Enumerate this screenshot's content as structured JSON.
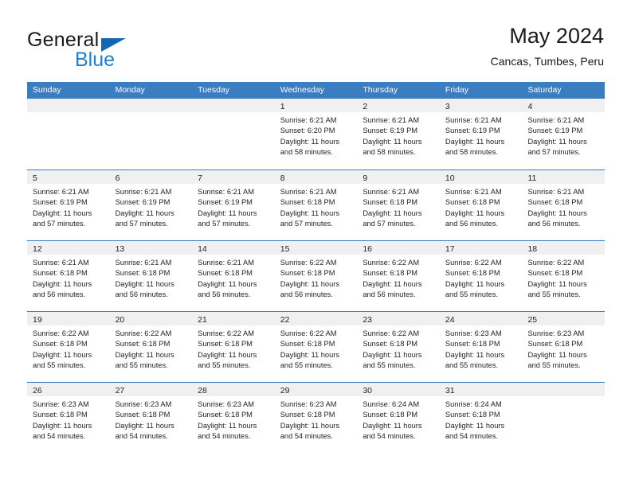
{
  "brand": {
    "name_part1": "General",
    "name_part2": "Blue",
    "triangle_color": "#1267b2",
    "blue_color": "#1d7fd1"
  },
  "header": {
    "title": "May 2024",
    "subtitle": "Cancas, Tumbes, Peru"
  },
  "theme": {
    "header_blue": "#3a7dc0",
    "daynum_band": "#f0f0f0",
    "text": "#231f20"
  },
  "weekdays": [
    "Sunday",
    "Monday",
    "Tuesday",
    "Wednesday",
    "Thursday",
    "Friday",
    "Saturday"
  ],
  "weeks": [
    [
      {
        "day": "",
        "sunrise": "",
        "sunset": "",
        "daylight1": "",
        "daylight2": ""
      },
      {
        "day": "",
        "sunrise": "",
        "sunset": "",
        "daylight1": "",
        "daylight2": ""
      },
      {
        "day": "",
        "sunrise": "",
        "sunset": "",
        "daylight1": "",
        "daylight2": ""
      },
      {
        "day": "1",
        "sunrise": "Sunrise: 6:21 AM",
        "sunset": "Sunset: 6:20 PM",
        "daylight1": "Daylight: 11 hours",
        "daylight2": "and 58 minutes."
      },
      {
        "day": "2",
        "sunrise": "Sunrise: 6:21 AM",
        "sunset": "Sunset: 6:19 PM",
        "daylight1": "Daylight: 11 hours",
        "daylight2": "and 58 minutes."
      },
      {
        "day": "3",
        "sunrise": "Sunrise: 6:21 AM",
        "sunset": "Sunset: 6:19 PM",
        "daylight1": "Daylight: 11 hours",
        "daylight2": "and 58 minutes."
      },
      {
        "day": "4",
        "sunrise": "Sunrise: 6:21 AM",
        "sunset": "Sunset: 6:19 PM",
        "daylight1": "Daylight: 11 hours",
        "daylight2": "and 57 minutes."
      }
    ],
    [
      {
        "day": "5",
        "sunrise": "Sunrise: 6:21 AM",
        "sunset": "Sunset: 6:19 PM",
        "daylight1": "Daylight: 11 hours",
        "daylight2": "and 57 minutes."
      },
      {
        "day": "6",
        "sunrise": "Sunrise: 6:21 AM",
        "sunset": "Sunset: 6:19 PM",
        "daylight1": "Daylight: 11 hours",
        "daylight2": "and 57 minutes."
      },
      {
        "day": "7",
        "sunrise": "Sunrise: 6:21 AM",
        "sunset": "Sunset: 6:19 PM",
        "daylight1": "Daylight: 11 hours",
        "daylight2": "and 57 minutes."
      },
      {
        "day": "8",
        "sunrise": "Sunrise: 6:21 AM",
        "sunset": "Sunset: 6:18 PM",
        "daylight1": "Daylight: 11 hours",
        "daylight2": "and 57 minutes."
      },
      {
        "day": "9",
        "sunrise": "Sunrise: 6:21 AM",
        "sunset": "Sunset: 6:18 PM",
        "daylight1": "Daylight: 11 hours",
        "daylight2": "and 57 minutes."
      },
      {
        "day": "10",
        "sunrise": "Sunrise: 6:21 AM",
        "sunset": "Sunset: 6:18 PM",
        "daylight1": "Daylight: 11 hours",
        "daylight2": "and 56 minutes."
      },
      {
        "day": "11",
        "sunrise": "Sunrise: 6:21 AM",
        "sunset": "Sunset: 6:18 PM",
        "daylight1": "Daylight: 11 hours",
        "daylight2": "and 56 minutes."
      }
    ],
    [
      {
        "day": "12",
        "sunrise": "Sunrise: 6:21 AM",
        "sunset": "Sunset: 6:18 PM",
        "daylight1": "Daylight: 11 hours",
        "daylight2": "and 56 minutes."
      },
      {
        "day": "13",
        "sunrise": "Sunrise: 6:21 AM",
        "sunset": "Sunset: 6:18 PM",
        "daylight1": "Daylight: 11 hours",
        "daylight2": "and 56 minutes."
      },
      {
        "day": "14",
        "sunrise": "Sunrise: 6:21 AM",
        "sunset": "Sunset: 6:18 PM",
        "daylight1": "Daylight: 11 hours",
        "daylight2": "and 56 minutes."
      },
      {
        "day": "15",
        "sunrise": "Sunrise: 6:22 AM",
        "sunset": "Sunset: 6:18 PM",
        "daylight1": "Daylight: 11 hours",
        "daylight2": "and 56 minutes."
      },
      {
        "day": "16",
        "sunrise": "Sunrise: 6:22 AM",
        "sunset": "Sunset: 6:18 PM",
        "daylight1": "Daylight: 11 hours",
        "daylight2": "and 56 minutes."
      },
      {
        "day": "17",
        "sunrise": "Sunrise: 6:22 AM",
        "sunset": "Sunset: 6:18 PM",
        "daylight1": "Daylight: 11 hours",
        "daylight2": "and 55 minutes."
      },
      {
        "day": "18",
        "sunrise": "Sunrise: 6:22 AM",
        "sunset": "Sunset: 6:18 PM",
        "daylight1": "Daylight: 11 hours",
        "daylight2": "and 55 minutes."
      }
    ],
    [
      {
        "day": "19",
        "sunrise": "Sunrise: 6:22 AM",
        "sunset": "Sunset: 6:18 PM",
        "daylight1": "Daylight: 11 hours",
        "daylight2": "and 55 minutes."
      },
      {
        "day": "20",
        "sunrise": "Sunrise: 6:22 AM",
        "sunset": "Sunset: 6:18 PM",
        "daylight1": "Daylight: 11 hours",
        "daylight2": "and 55 minutes."
      },
      {
        "day": "21",
        "sunrise": "Sunrise: 6:22 AM",
        "sunset": "Sunset: 6:18 PM",
        "daylight1": "Daylight: 11 hours",
        "daylight2": "and 55 minutes."
      },
      {
        "day": "22",
        "sunrise": "Sunrise: 6:22 AM",
        "sunset": "Sunset: 6:18 PM",
        "daylight1": "Daylight: 11 hours",
        "daylight2": "and 55 minutes."
      },
      {
        "day": "23",
        "sunrise": "Sunrise: 6:22 AM",
        "sunset": "Sunset: 6:18 PM",
        "daylight1": "Daylight: 11 hours",
        "daylight2": "and 55 minutes."
      },
      {
        "day": "24",
        "sunrise": "Sunrise: 6:23 AM",
        "sunset": "Sunset: 6:18 PM",
        "daylight1": "Daylight: 11 hours",
        "daylight2": "and 55 minutes."
      },
      {
        "day": "25",
        "sunrise": "Sunrise: 6:23 AM",
        "sunset": "Sunset: 6:18 PM",
        "daylight1": "Daylight: 11 hours",
        "daylight2": "and 55 minutes."
      }
    ],
    [
      {
        "day": "26",
        "sunrise": "Sunrise: 6:23 AM",
        "sunset": "Sunset: 6:18 PM",
        "daylight1": "Daylight: 11 hours",
        "daylight2": "and 54 minutes."
      },
      {
        "day": "27",
        "sunrise": "Sunrise: 6:23 AM",
        "sunset": "Sunset: 6:18 PM",
        "daylight1": "Daylight: 11 hours",
        "daylight2": "and 54 minutes."
      },
      {
        "day": "28",
        "sunrise": "Sunrise: 6:23 AM",
        "sunset": "Sunset: 6:18 PM",
        "daylight1": "Daylight: 11 hours",
        "daylight2": "and 54 minutes."
      },
      {
        "day": "29",
        "sunrise": "Sunrise: 6:23 AM",
        "sunset": "Sunset: 6:18 PM",
        "daylight1": "Daylight: 11 hours",
        "daylight2": "and 54 minutes."
      },
      {
        "day": "30",
        "sunrise": "Sunrise: 6:24 AM",
        "sunset": "Sunset: 6:18 PM",
        "daylight1": "Daylight: 11 hours",
        "daylight2": "and 54 minutes."
      },
      {
        "day": "31",
        "sunrise": "Sunrise: 6:24 AM",
        "sunset": "Sunset: 6:18 PM",
        "daylight1": "Daylight: 11 hours",
        "daylight2": "and 54 minutes."
      },
      {
        "day": "",
        "sunrise": "",
        "sunset": "",
        "daylight1": "",
        "daylight2": ""
      }
    ]
  ]
}
